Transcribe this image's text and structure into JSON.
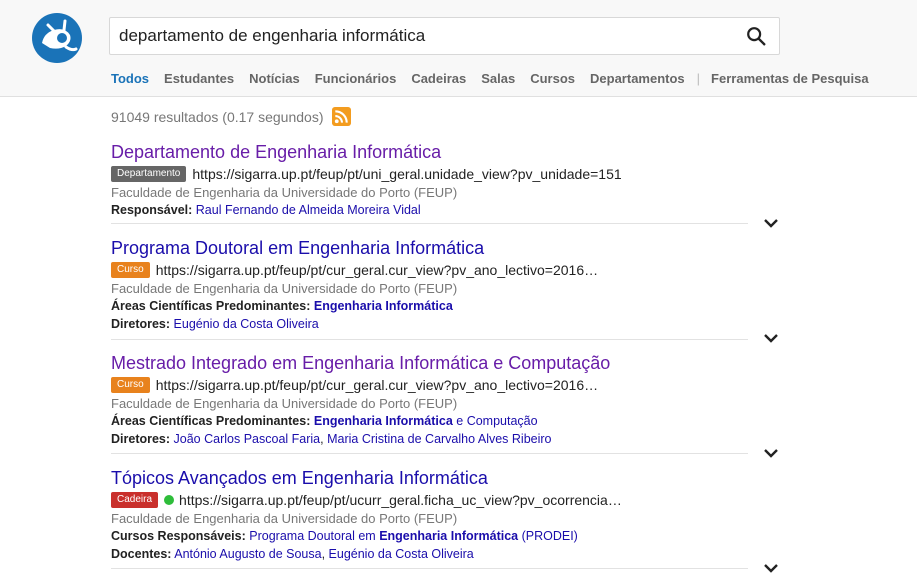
{
  "search": {
    "value": "departamento de engenharia informática"
  },
  "tabs": [
    {
      "label": "Todos"
    },
    {
      "label": "Estudantes"
    },
    {
      "label": "Notícias"
    },
    {
      "label": "Funcionários"
    },
    {
      "label": "Cadeiras"
    },
    {
      "label": "Salas"
    },
    {
      "label": "Cursos"
    },
    {
      "label": "Departamentos"
    },
    {
      "label": "Ferramentas de Pesquisa"
    }
  ],
  "stats": {
    "text": "91049 resultados (0.17 segundos)"
  },
  "colors": {
    "accent": "#1a73b8",
    "link": "#1a0dab",
    "visited": "#681da8",
    "badge_departamento": "#666666",
    "badge_curso": "#e8821d",
    "badge_cadeira": "#c9302c",
    "status_dot": "#2ebd3a"
  },
  "results": [
    {
      "title": "Departamento de Engenharia Informática",
      "badge": "Departamento",
      "url": "https://sigarra.up.pt/feup/pt/uni_geral.unidade_view?pv_unidade=151",
      "faculty": "Faculdade de Engenharia da Universidade do Porto (FEUP)",
      "meta1_label": "Responsável:",
      "meta1_value": "Raul Fernando de Almeida Moreira Vidal"
    },
    {
      "title": "Programa Doutoral em Engenharia Informática",
      "badge": "Curso",
      "url": "https://sigarra.up.pt/feup/pt/cur_geral.cur_view?pv_ano_lectivo=2016…",
      "faculty": "Faculdade de Engenharia da Universidade do Porto (FEUP)",
      "meta1_label": "Áreas Científicas Predominantes:",
      "meta1_value": "Engenharia Informática",
      "meta2_label": "Diretores:",
      "meta2_value": "Eugénio da Costa Oliveira"
    },
    {
      "title": "Mestrado Integrado em Engenharia Informática e Computação",
      "badge": "Curso",
      "url": "https://sigarra.up.pt/feup/pt/cur_geral.cur_view?pv_ano_lectivo=2016…",
      "faculty": "Faculdade de Engenharia da Universidade do Porto (FEUP)",
      "meta1_label": "Áreas Científicas Predominantes:",
      "meta1_value_bold": "Engenharia Informática",
      "meta1_value_rest": " e Computação",
      "meta2_label": "Diretores:",
      "meta2_value_a": "João Carlos Pascoal Faria",
      "meta2_sep": ", ",
      "meta2_value_b": "Maria Cristina de Carvalho Alves Ribeiro"
    },
    {
      "title": "Tópicos Avançados em Engenharia Informática",
      "badge": "Cadeira",
      "url": "https://sigarra.up.pt/feup/pt/ucurr_geral.ficha_uc_view?pv_ocorrencia…",
      "faculty": "Faculdade de Engenharia da Universidade do Porto (FEUP)",
      "meta1_label": "Cursos Responsáveis:",
      "meta1_value_a": "Programa Doutoral em ",
      "meta1_value_bold": "Engenharia Informática",
      "meta1_value_c": " (PRODEI)",
      "meta2_label": "Docentes:",
      "meta2_value_a": "António Augusto de Sousa",
      "meta2_sep": ", ",
      "meta2_value_b": "Eugénio da Costa Oliveira"
    }
  ]
}
